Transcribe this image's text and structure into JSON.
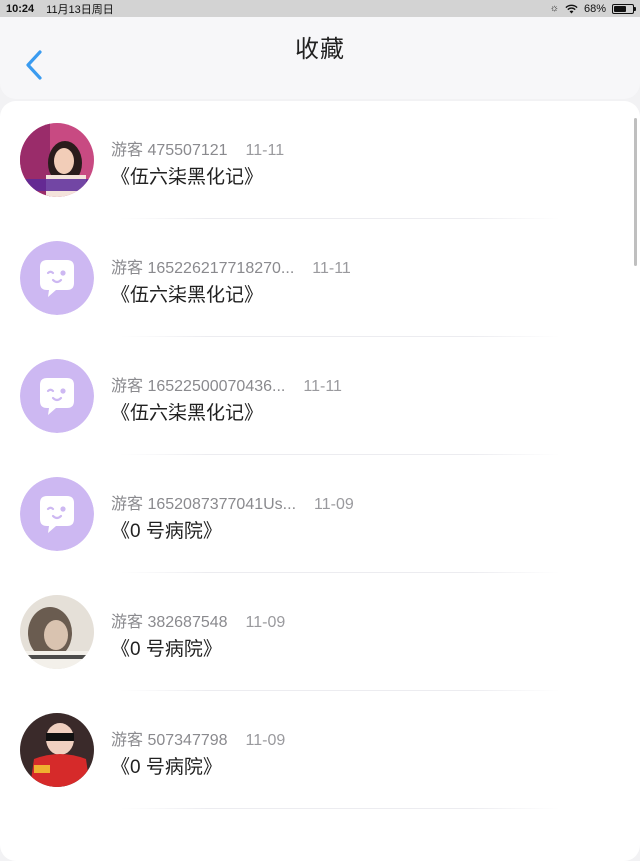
{
  "status_bar": {
    "time": "10:24",
    "date": "11月13日周日",
    "battery": "68%",
    "battery_level": 0.68
  },
  "header": {
    "title": "收藏"
  },
  "items": [
    {
      "user": "游客 475507121",
      "date": "11-11",
      "book": "《伍六柒黑化记》",
      "avatar": "photo"
    },
    {
      "user": "游客 165226217718270...",
      "date": "11-11",
      "book": "《伍六柒黑化记》",
      "avatar": "default"
    },
    {
      "user": "游客 16522500070436...",
      "date": "11-11",
      "book": "《伍六柒黑化记》",
      "avatar": "default"
    },
    {
      "user": "游客 1652087377041Us...",
      "date": "11-09",
      "book": "《0 号病院》",
      "avatar": "default"
    },
    {
      "user": "游客 382687548",
      "date": "11-09",
      "book": "《0 号病院》",
      "avatar": "photo"
    },
    {
      "user": "游客 507347798",
      "date": "11-09",
      "book": "《0 号病院》",
      "avatar": "photo"
    }
  ],
  "colors": {
    "accent": "#3a9bf0",
    "default_avatar": "#cdb8f2"
  }
}
